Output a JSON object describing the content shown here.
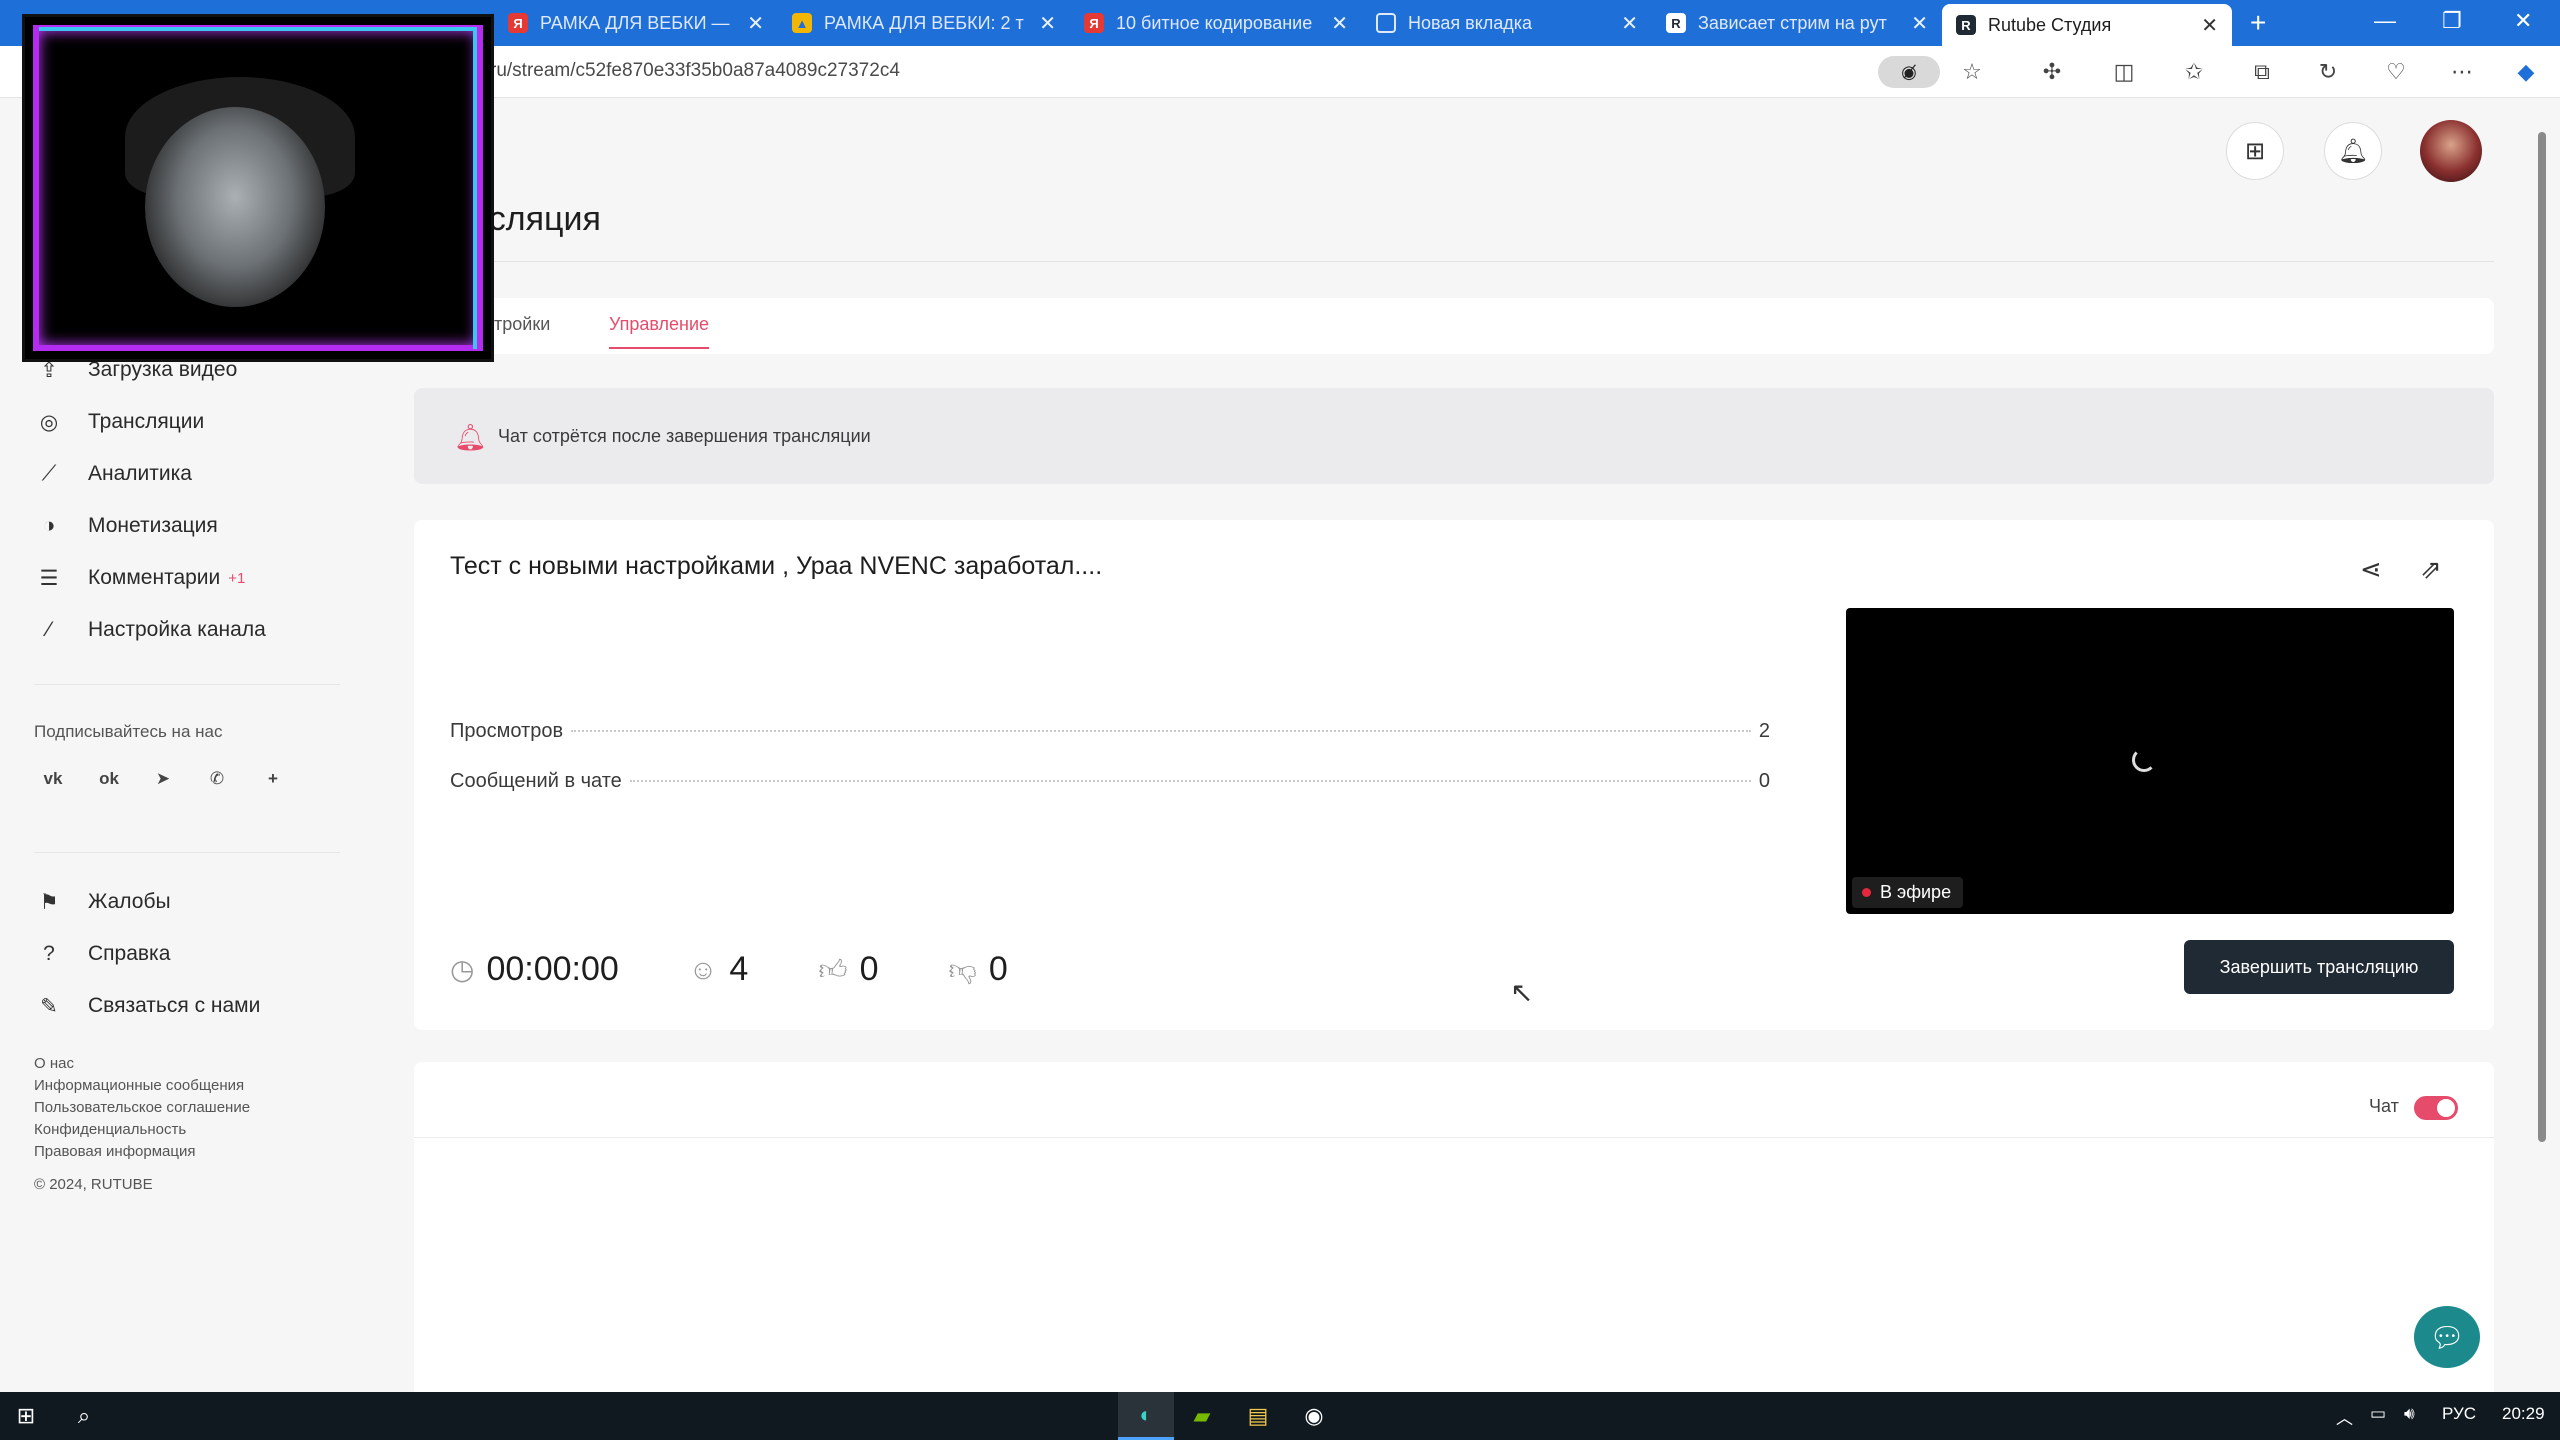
{
  "browser": {
    "tabs": [
      {
        "label": "РАМКА ДЛЯ ВЕБКИ — Я",
        "icon": "yandex-icon"
      },
      {
        "label": "РАМКА ДЛЯ ВЕБКИ: 2 т",
        "icon": "image-icon"
      },
      {
        "label": "10 битное кодирование",
        "icon": "yandex-icon"
      },
      {
        "label": "Новая вкладка",
        "icon": "page-icon"
      },
      {
        "label": "Зависает стрим на рут",
        "icon": "rutube-icon"
      },
      {
        "label": "Rutube Студия",
        "icon": "rutube-icon"
      }
    ],
    "new_tab": "+",
    "url": "ru/stream/c52fe870e33f35b0a87a4089c27372c4"
  },
  "page": {
    "title_visible": "нсляция",
    "tabs": [
      {
        "label": "тройки"
      },
      {
        "label": "Управление"
      }
    ]
  },
  "sidebar": {
    "items": [
      {
        "label": "Загрузка видео",
        "icon": "upload-icon"
      },
      {
        "label": "Трансляции",
        "icon": "broadcast-icon"
      },
      {
        "label": "Аналитика",
        "icon": "analytics-icon"
      },
      {
        "label": "Монетизация",
        "icon": "monetization-icon"
      },
      {
        "label": "Комментарии",
        "icon": "comments-icon",
        "badge": "+1"
      },
      {
        "label": "Настройка канала",
        "icon": "settings-wand-icon"
      }
    ],
    "follow_label": "Подписывайтесь на нас",
    "social": [
      "vk",
      "ok",
      "telegram",
      "viber",
      "more"
    ],
    "bottom_items": [
      {
        "label": "Жалобы",
        "icon": "flag-icon"
      },
      {
        "label": "Справка",
        "icon": "help-icon"
      },
      {
        "label": "Связаться с нами",
        "icon": "edit-icon"
      }
    ],
    "footer_links": [
      "О нас",
      "Информационные сообщения",
      "Пользовательское соглашение",
      "Конфиденциальность",
      "Правовая информация"
    ],
    "copyright": "© 2024, RUTUBE"
  },
  "notice": {
    "text": "Чат сотрётся после завершения трансляции"
  },
  "stream": {
    "title": "Тест с новыми настройками , Ураа NVENC заработал....",
    "stats": [
      {
        "label": "Просмотров",
        "value": "2"
      },
      {
        "label": "Сообщений в чате",
        "value": "0"
      }
    ],
    "timer": "00:00:00",
    "viewers": "4",
    "likes": "0",
    "dislikes": "0",
    "live_badge": "В эфире",
    "end_button": "Завершить трансляцию"
  },
  "chat": {
    "label": "Чат",
    "enabled": true
  },
  "taskbar": {
    "lang": "РУС",
    "time": "20:29"
  },
  "colors": {
    "accent": "#e64b6b",
    "browser_blue": "#1f6fd8",
    "end_button": "#1f2a35",
    "help_fab": "#1c8a8c"
  }
}
